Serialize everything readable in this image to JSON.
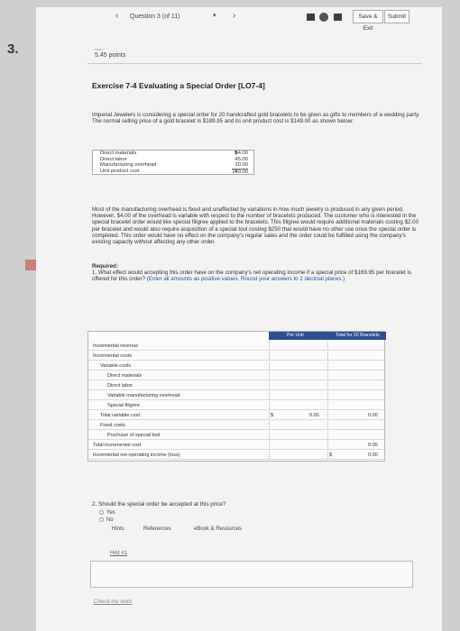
{
  "question_number": "3.",
  "topbar": {
    "nav_prev": "‹",
    "question_label": "Question 3 (of 11)",
    "dropdown": "▾",
    "nav_next": "›",
    "save_exit": "Save & Exit",
    "submit": "Submit"
  },
  "points": "5.45 points",
  "points_caption": "value",
  "title": "Exercise 7-4 Evaluating a Special Order [LO7-4]",
  "intro": "Imperial Jewelers is considering a special order for 20 handcrafted gold bracelets to be given as gifts to members of a wedding party. The normal selling price of a gold bracelet is $189.95 and its unit product cost is $149.00 as shown below:",
  "cost_table": [
    {
      "label": "Direct materials",
      "cur": "$",
      "value": "84.00"
    },
    {
      "label": "Direct labor",
      "cur": "",
      "value": "45.00"
    },
    {
      "label": "Manufacturing overhead",
      "cur": "",
      "value": "20.00"
    },
    {
      "label": "Unit product cost",
      "cur": "$",
      "value": "149.00"
    }
  ],
  "body2": "Most of the manufacturing overhead is fixed and unaffected by variations in how much jewelry is produced in any given period. However, $4.00 of the overhead is variable with respect to the number of bracelets produced. The customer who is interested in the special bracelet order would like special filigree applied to the bracelets. This filigree would require additional materials costing $2.00 per bracelet and would also require acquisition of a special tool costing $250 that would have no other use once the special order is completed. This order would have no effect on the company's regular sales and the order could be fulfilled using the company's existing capacity without affecting any other order.",
  "required": {
    "heading": "Required:",
    "text": "1. What effect would accepting this order have on the company's net operating income if a special price of $169.95 per bracelet is offered for this order?",
    "instruction": "(Enter all amounts as positive values. Round your answers to 2 decimal places.)"
  },
  "answer_table": {
    "col_per_unit": "Per Unit",
    "col_total": "Total for 20 Bracelets",
    "rows": [
      {
        "label": "Incremental revenue",
        "indent": 0,
        "cur1": "",
        "val1": "",
        "cur2": "",
        "val2": ""
      },
      {
        "label": "Incremental costs",
        "indent": 0,
        "cur1": "",
        "val1": "",
        "cur2": "",
        "val2": ""
      },
      {
        "label": "Variable costs",
        "indent": 1,
        "cur1": "",
        "val1": "",
        "cur2": "",
        "val2": ""
      },
      {
        "label": "Direct materials",
        "indent": 2,
        "cur1": "",
        "val1": "",
        "cur2": "",
        "val2": ""
      },
      {
        "label": "Direct labor",
        "indent": 2,
        "cur1": "",
        "val1": "",
        "cur2": "",
        "val2": ""
      },
      {
        "label": "Variable manufacturing overhead",
        "indent": 2,
        "cur1": "",
        "val1": "",
        "cur2": "",
        "val2": ""
      },
      {
        "label": "Special filigree",
        "indent": 2,
        "cur1": "",
        "val1": "",
        "cur2": "",
        "val2": ""
      },
      {
        "label": "Total variable cost",
        "indent": 1,
        "cur1": "$",
        "val1": "0.00",
        "cur2": "",
        "val2": "0.00"
      },
      {
        "label": "Fixed costs",
        "indent": 1,
        "cur1": "",
        "val1": "",
        "cur2": "",
        "val2": ""
      },
      {
        "label": "Purchase of special tool",
        "indent": 2,
        "cur1": "",
        "val1": "",
        "cur2": "",
        "val2": ""
      },
      {
        "label": "Total incremental cost",
        "indent": 0,
        "cur1": "",
        "val1": "",
        "cur2": "",
        "val2": "0.00"
      },
      {
        "label": "Incremental net operating income (loss)",
        "indent": 0,
        "cur1": "",
        "val1": "",
        "cur2": "$",
        "val2": "0.00"
      }
    ]
  },
  "q2": {
    "text": "2. Should the special order be accepted at this price?",
    "options": [
      "Yes",
      "No"
    ]
  },
  "hints_tabs": [
    "Hints",
    "References",
    "eBook & Resources"
  ],
  "hint1": "Hint #1",
  "check_work": "Check my work",
  "colors": {
    "header_blue": "#2e4f8f",
    "accent_red": "#c2402f"
  }
}
